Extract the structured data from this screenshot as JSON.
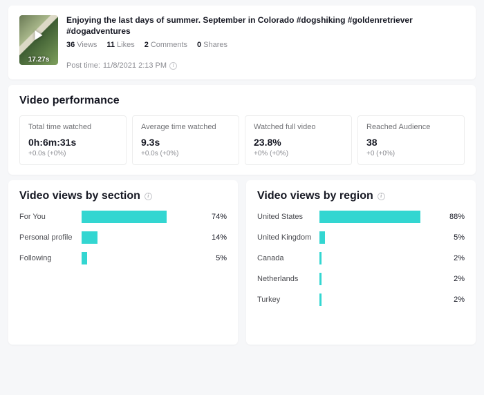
{
  "post": {
    "title": "Enjoying the last days of summer. September in Colorado #dogshiking #goldenretriever #dogadventures",
    "duration": "17.27s",
    "stats": {
      "views_n": "36",
      "views_l": "Views",
      "likes_n": "11",
      "likes_l": "Likes",
      "comments_n": "2",
      "comments_l": "Comments",
      "shares_n": "0",
      "shares_l": "Shares"
    },
    "post_time_label": "Post time:",
    "post_time_value": "11/8/2021 2:13 PM"
  },
  "performance": {
    "title": "Video performance",
    "metrics": [
      {
        "label": "Total time watched",
        "value": "0h:6m:31s",
        "delta": "+0.0s (+0%)"
      },
      {
        "label": "Average time watched",
        "value": "9.3s",
        "delta": "+0.0s (+0%)"
      },
      {
        "label": "Watched full video",
        "value": "23.8%",
        "delta": "+0% (+0%)"
      },
      {
        "label": "Reached Audience",
        "value": "38",
        "delta": "+0 (+0%)"
      }
    ]
  },
  "section_chart": {
    "title": "Video views by section",
    "series": [
      {
        "category": "For You",
        "value": 74
      },
      {
        "category": "Personal profile",
        "value": 14
      },
      {
        "category": "Following",
        "value": 5
      }
    ]
  },
  "region_chart": {
    "title": "Video views by region",
    "series": [
      {
        "category": "United States",
        "value": 88
      },
      {
        "category": "United Kingdom",
        "value": 5
      },
      {
        "category": "Canada",
        "value": 2
      },
      {
        "category": "Netherlands",
        "value": 2
      },
      {
        "category": "Turkey",
        "value": 2
      }
    ]
  },
  "chart_data": [
    {
      "type": "bar",
      "title": "Video views by section",
      "xlabel": "",
      "ylabel": "",
      "categories": [
        "For You",
        "Personal profile",
        "Following"
      ],
      "values": [
        74,
        14,
        5
      ],
      "unit": "%",
      "xlim": [
        0,
        100
      ],
      "orientation": "horizontal",
      "color": "#33d6d1"
    },
    {
      "type": "bar",
      "title": "Video views by region",
      "xlabel": "",
      "ylabel": "",
      "categories": [
        "United States",
        "United Kingdom",
        "Canada",
        "Netherlands",
        "Turkey"
      ],
      "values": [
        88,
        5,
        2,
        2,
        2
      ],
      "unit": "%",
      "xlim": [
        0,
        100
      ],
      "orientation": "horizontal",
      "color": "#33d6d1"
    }
  ]
}
